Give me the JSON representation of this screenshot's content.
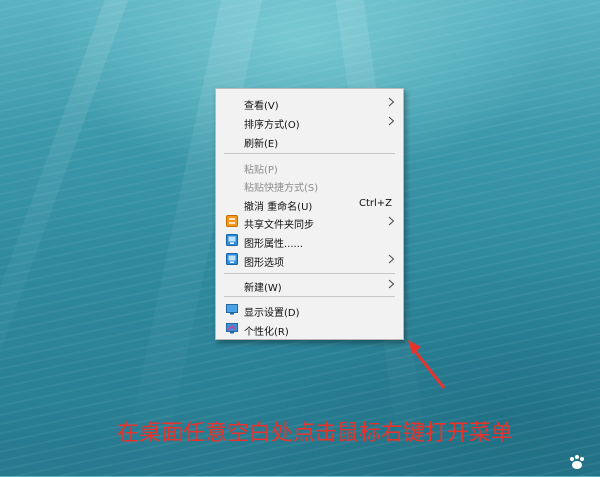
{
  "context_menu": {
    "items": [
      {
        "label": "查看(V)",
        "enabled": true,
        "submenu": true
      },
      {
        "label": "排序方式(O)",
        "enabled": true,
        "submenu": true
      },
      {
        "label": "刷新(E)",
        "enabled": true
      },
      {
        "label": "粘贴(P)",
        "enabled": false
      },
      {
        "label": "粘贴快捷方式(S)",
        "enabled": false
      },
      {
        "label": "撤消 重命名(U)",
        "enabled": true,
        "shortcut": "Ctrl+Z"
      },
      {
        "label": "共享文件夹同步",
        "enabled": true,
        "submenu": true,
        "icon": "sync-folder-icon"
      },
      {
        "label": "图形属性......",
        "enabled": true,
        "icon": "graphics-properties-icon"
      },
      {
        "label": "图形选项",
        "enabled": true,
        "submenu": true,
        "icon": "graphics-options-icon"
      },
      {
        "label": "新建(W)",
        "enabled": true,
        "submenu": true
      },
      {
        "label": "显示设置(D)",
        "enabled": true,
        "icon": "display-settings-icon"
      },
      {
        "label": "个性化(R)",
        "enabled": true,
        "icon": "personalize-icon"
      }
    ]
  },
  "caption": "在桌面任意空白处点击鼠标右键打开菜单",
  "colors": {
    "menu_bg": "#f2f2f2",
    "caption": "#e8322c",
    "arrow": "#e8322c",
    "desktop": "#3c99aa"
  }
}
